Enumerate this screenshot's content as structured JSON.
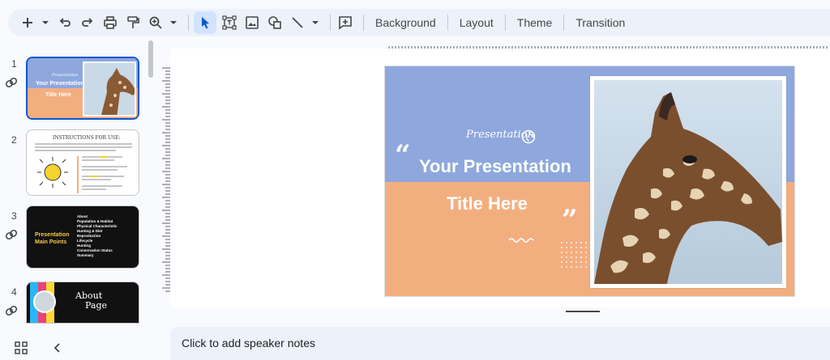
{
  "toolbar": {
    "icons": [
      "plus-icon",
      "caret-icon",
      "undo-icon",
      "redo-icon",
      "print-icon",
      "paint-format-icon",
      "zoom-icon",
      "caret-icon",
      "select-icon",
      "textbox-icon",
      "image-icon",
      "shape-icon",
      "line-icon",
      "caret-icon",
      "comment-add-icon"
    ],
    "background_label": "Background",
    "layout_label": "Layout",
    "theme_label": "Theme",
    "transition_label": "Transition"
  },
  "filmstrip": {
    "slides": [
      {
        "number": "1",
        "linked": true,
        "thumb_brand": "Presentation",
        "thumb_title_1": "Your Presentation",
        "thumb_title_2": "Title Here"
      },
      {
        "number": "2",
        "linked": false,
        "thumb_heading": "INSTRUCTIONS FOR USE:"
      },
      {
        "number": "3",
        "linked": true,
        "thumb_title_1": "Presentation",
        "thumb_title_2": "Main Points",
        "thumb_items": [
          "About",
          "Population & Habitat",
          "Physical Characteristic",
          "Hunting & Diet",
          "Reproduction",
          "Lifecycle",
          "Hunting",
          "Conservation Status",
          "Summary"
        ]
      },
      {
        "number": "4",
        "linked": true,
        "thumb_title_1": "About",
        "thumb_title_2": "Page"
      }
    ]
  },
  "slide": {
    "brand": "Presentation",
    "title_line_1": "Your Presentation",
    "title_line_2": "Title Here",
    "quote_open": "“",
    "quote_close": "”",
    "colors": {
      "top": "#8ea7dd",
      "bottom": "#f3ae80"
    }
  },
  "notes": {
    "placeholder": "Click to add speaker notes"
  },
  "bottom_controls": {
    "grid_icon": "grid-view-icon",
    "collapse_icon": "chevron-left-icon"
  }
}
